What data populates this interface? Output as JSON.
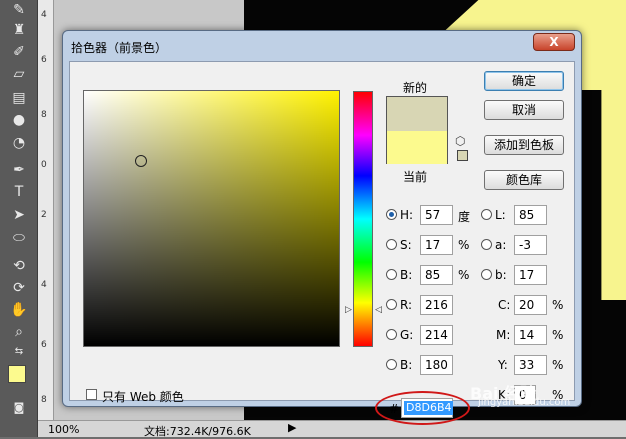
{
  "dialog": {
    "title": "拾色器（前景色）",
    "close_label": "X",
    "new_label": "新的",
    "current_label": "当前",
    "new_color": "#d8d6b4",
    "current_color": "#fcfa8e",
    "buttons": {
      "ok": "确定",
      "cancel": "取消",
      "add_swatch": "添加到色板",
      "color_libraries": "颜色库"
    },
    "hsb": [
      {
        "label": "H:",
        "value": "57",
        "unit": "度",
        "selected": true
      },
      {
        "label": "S:",
        "value": "17",
        "unit": "%",
        "selected": false
      },
      {
        "label": "B:",
        "value": "85",
        "unit": "%",
        "selected": false
      }
    ],
    "lab": [
      {
        "label": "L:",
        "value": "85"
      },
      {
        "label": "a:",
        "value": "-3"
      },
      {
        "label": "b:",
        "value": "17"
      }
    ],
    "rgb": [
      {
        "label": "R:",
        "value": "216"
      },
      {
        "label": "G:",
        "value": "214"
      },
      {
        "label": "B:",
        "value": "180"
      }
    ],
    "cmyk": [
      {
        "label": "C:",
        "value": "20",
        "unit": "%"
      },
      {
        "label": "M:",
        "value": "14",
        "unit": "%"
      },
      {
        "label": "Y:",
        "value": "33",
        "unit": "%"
      },
      {
        "label": "K:",
        "value": "0",
        "unit": "%"
      }
    ],
    "hex_prefix": "#",
    "hex_value": "D8D6B4",
    "web_only_label": "只有 Web 颜色"
  },
  "status": {
    "zoom": "100%",
    "doc_info": "文档:732.4K/976.6K"
  },
  "rulers": [
    "4",
    "6",
    "8",
    "0",
    "2",
    "4",
    "6",
    "8"
  ],
  "watermark": {
    "brand": "Bai 经验",
    "url": "jingyan.baidu.com"
  },
  "colors": {
    "highlight": "#d01818",
    "foreground": "#fcfa8e"
  }
}
